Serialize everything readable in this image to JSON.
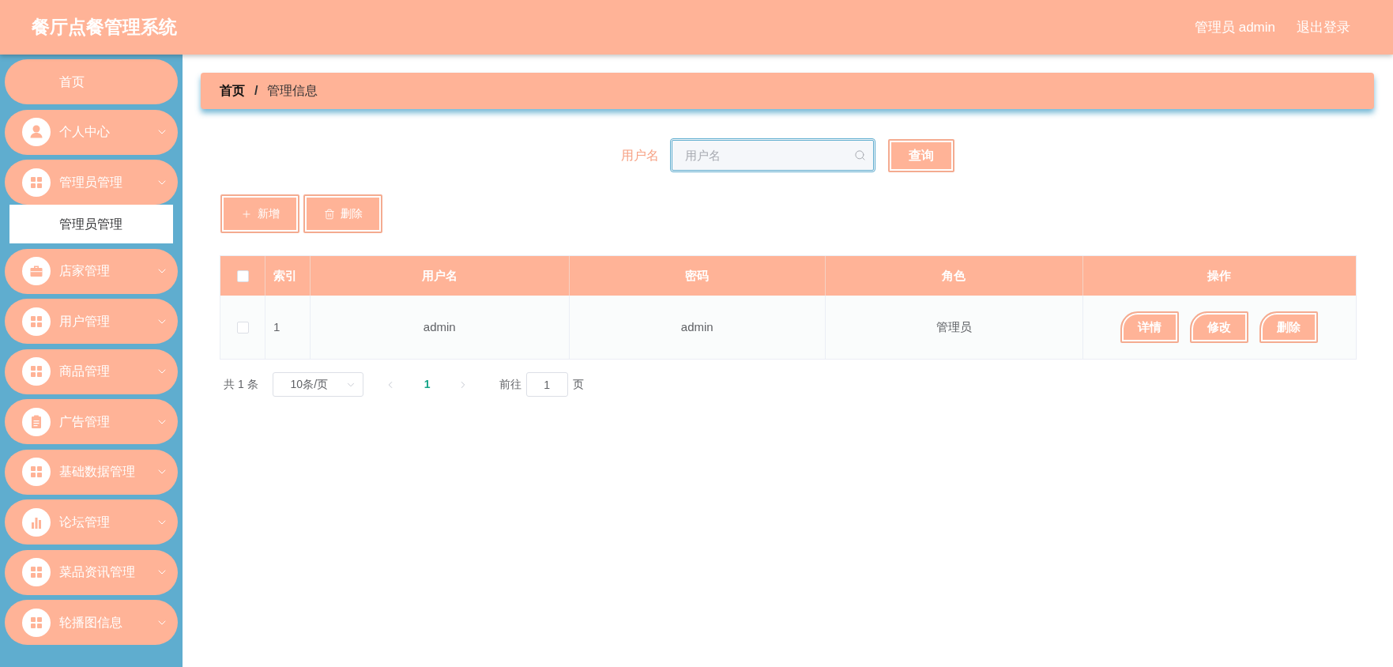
{
  "header": {
    "title": "餐厅点餐管理系统",
    "user": "管理员 admin",
    "logout": "退出登录"
  },
  "sidebar": {
    "items": [
      {
        "kind": "link",
        "label": "首页"
      },
      {
        "kind": "menu",
        "label": "个人中心"
      },
      {
        "kind": "menu",
        "label": "管理员管理",
        "children": [
          {
            "label": "管理员管理",
            "selected": true
          }
        ]
      },
      {
        "kind": "menu",
        "label": "店家管理"
      },
      {
        "kind": "menu",
        "label": "用户管理"
      },
      {
        "kind": "menu",
        "label": "商品管理"
      },
      {
        "kind": "menu",
        "label": "广告管理"
      },
      {
        "kind": "menu",
        "label": "基础数据管理"
      },
      {
        "kind": "menu",
        "label": "论坛管理"
      },
      {
        "kind": "menu",
        "label": "菜品资讯管理"
      },
      {
        "kind": "menu",
        "label": "轮播图信息"
      }
    ]
  },
  "breadcrumb": {
    "items": [
      "首页",
      "管理信息"
    ],
    "separator": "/"
  },
  "search": {
    "label": "用户名",
    "placeholder": "用户名",
    "button": "查询"
  },
  "toolbar": {
    "buttons": [
      "新增",
      "删除"
    ]
  },
  "table": {
    "select_all": {
      "checked": false
    },
    "columns": [
      "索引",
      "用户名",
      "密码",
      "角色",
      "操作"
    ],
    "rows": [
      {
        "checked": false,
        "cells": [
          "1",
          "admin",
          "admin",
          "管理员"
        ],
        "actions": [
          "详情",
          "修改",
          "删除"
        ]
      }
    ]
  },
  "pagination": {
    "total": "共 1 条",
    "page_size": "10条/页",
    "prev": {
      "disabled": true
    },
    "pages": [
      {
        "label": "1",
        "selected": true
      }
    ],
    "next": {
      "disabled": true
    },
    "goto_label": "前往",
    "goto_value": "1",
    "goto_suffix": "页"
  }
}
